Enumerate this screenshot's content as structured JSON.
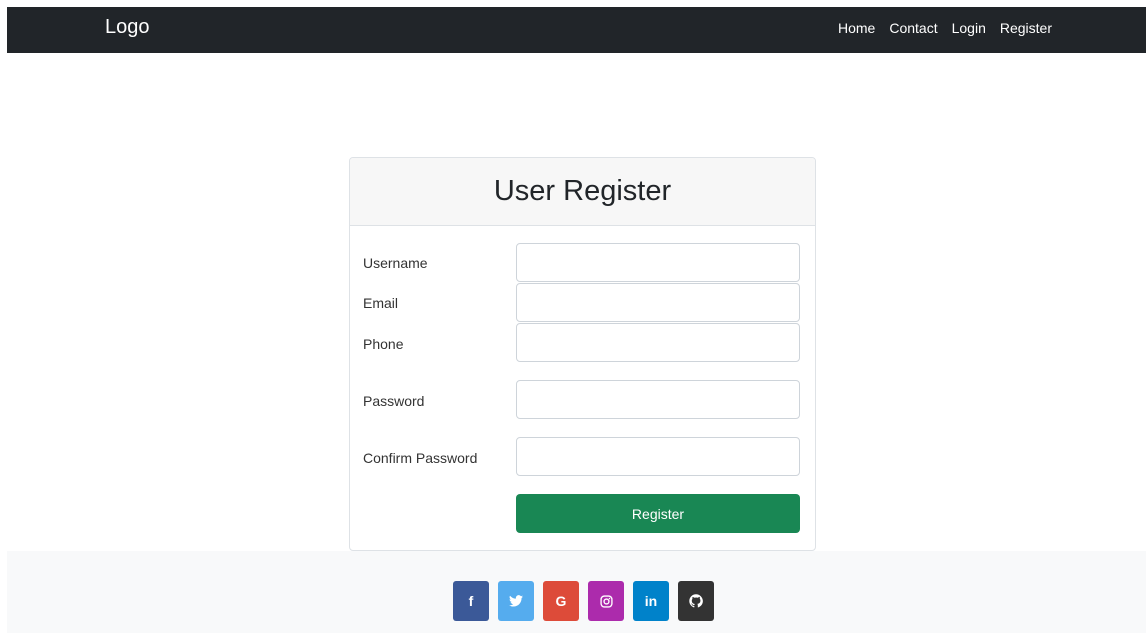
{
  "navbar": {
    "brand": "Logo",
    "links": [
      "Home",
      "Contact",
      "Login",
      "Register"
    ]
  },
  "form": {
    "title": "User Register",
    "fields": [
      {
        "label": "Username",
        "value": ""
      },
      {
        "label": "Email",
        "value": ""
      },
      {
        "label": "Phone",
        "value": ""
      },
      {
        "label": "Password",
        "value": ""
      },
      {
        "label": "Confirm Password",
        "value": ""
      }
    ],
    "submit_label": "Register"
  },
  "footer": {
    "social": [
      {
        "icon": "facebook-icon",
        "glyph": "f",
        "color": "#3b5998"
      },
      {
        "icon": "twitter-icon",
        "glyph": "",
        "color": "#55acee"
      },
      {
        "icon": "google-icon",
        "glyph": "G",
        "color": "#dd4b39"
      },
      {
        "icon": "instagram-icon",
        "glyph": "",
        "color": "#ac2bac"
      },
      {
        "icon": "linkedin-icon",
        "glyph": "in",
        "color": "#0082ca"
      },
      {
        "icon": "github-icon",
        "glyph": "",
        "color": "#333333"
      }
    ]
  },
  "colors": {
    "navbar_bg": "#212529",
    "primary_button": "#198754",
    "footer_bg": "#f8f9fa"
  }
}
